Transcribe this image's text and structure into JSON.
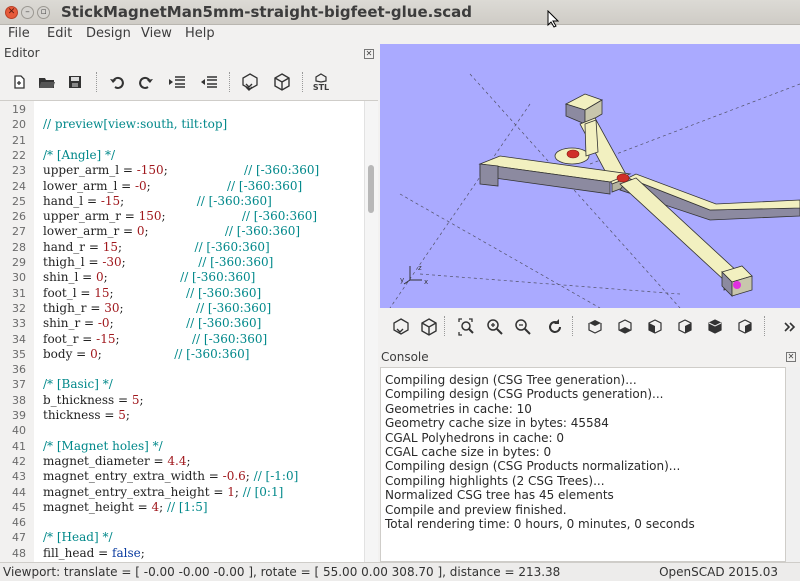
{
  "window": {
    "title": "StickMagnetMan5mm-straight-bigfeet-glue.scad"
  },
  "menu": [
    "File",
    "Edit",
    "Design",
    "View",
    "Help"
  ],
  "editor": {
    "label": "Editor",
    "toolbar": [
      {
        "name": "new-file-icon"
      },
      {
        "name": "open-file-icon"
      },
      {
        "name": "save-icon"
      },
      {
        "name": "undo-icon"
      },
      {
        "name": "redo-icon"
      },
      {
        "name": "indent-icon"
      },
      {
        "name": "unindent-icon"
      },
      {
        "name": "preview-icon"
      },
      {
        "name": "render-icon"
      },
      {
        "name": "export-stl-icon",
        "text": "STL"
      }
    ],
    "lines": [
      {
        "n": "19",
        "parts": []
      },
      {
        "n": "20",
        "parts": [
          {
            "t": "// preview[view:south, tilt:top]",
            "c": "cm"
          }
        ]
      },
      {
        "n": "21",
        "parts": []
      },
      {
        "n": "22",
        "parts": [
          {
            "t": "/* [Angle] */",
            "c": "cm"
          }
        ]
      },
      {
        "n": "23",
        "parts": [
          {
            "t": "upper_arm_l = ",
            "c": ""
          },
          {
            "t": "-150",
            "c": "num"
          },
          {
            "t": ";                    ",
            "c": ""
          },
          {
            "t": "// [-360:360]",
            "c": "cm"
          }
        ]
      },
      {
        "n": "24",
        "parts": [
          {
            "t": "lower_arm_l = ",
            "c": ""
          },
          {
            "t": "-0",
            "c": "num"
          },
          {
            "t": ";                    ",
            "c": ""
          },
          {
            "t": "// [-360:360]",
            "c": "cm"
          }
        ]
      },
      {
        "n": "25",
        "parts": [
          {
            "t": "hand_l = ",
            "c": ""
          },
          {
            "t": "-15",
            "c": "num"
          },
          {
            "t": ";                   ",
            "c": ""
          },
          {
            "t": "// [-360:360]",
            "c": "cm"
          }
        ]
      },
      {
        "n": "26",
        "parts": [
          {
            "t": "upper_arm_r = ",
            "c": ""
          },
          {
            "t": "150",
            "c": "num"
          },
          {
            "t": ";                    ",
            "c": ""
          },
          {
            "t": "// [-360:360]",
            "c": "cm"
          }
        ]
      },
      {
        "n": "27",
        "parts": [
          {
            "t": "lower_arm_r = ",
            "c": ""
          },
          {
            "t": "0",
            "c": "num"
          },
          {
            "t": ";                    ",
            "c": ""
          },
          {
            "t": "// [-360:360]",
            "c": "cm"
          }
        ]
      },
      {
        "n": "28",
        "parts": [
          {
            "t": "hand_r = ",
            "c": ""
          },
          {
            "t": "15",
            "c": "num"
          },
          {
            "t": ";                   ",
            "c": ""
          },
          {
            "t": "// [-360:360]",
            "c": "cm"
          }
        ]
      },
      {
        "n": "29",
        "parts": [
          {
            "t": "thigh_l = ",
            "c": ""
          },
          {
            "t": "-30",
            "c": "num"
          },
          {
            "t": ";                   ",
            "c": ""
          },
          {
            "t": "// [-360:360]",
            "c": "cm"
          }
        ]
      },
      {
        "n": "30",
        "parts": [
          {
            "t": "shin_l = ",
            "c": ""
          },
          {
            "t": "0",
            "c": "num"
          },
          {
            "t": ";                   ",
            "c": ""
          },
          {
            "t": "// [-360:360]",
            "c": "cm"
          }
        ]
      },
      {
        "n": "31",
        "parts": [
          {
            "t": "foot_l = ",
            "c": ""
          },
          {
            "t": "15",
            "c": "num"
          },
          {
            "t": ";                   ",
            "c": ""
          },
          {
            "t": "// [-360:360]",
            "c": "cm"
          }
        ]
      },
      {
        "n": "32",
        "parts": [
          {
            "t": "thigh_r = ",
            "c": ""
          },
          {
            "t": "30",
            "c": "num"
          },
          {
            "t": ";                   ",
            "c": ""
          },
          {
            "t": "// [-360:360]",
            "c": "cm"
          }
        ]
      },
      {
        "n": "33",
        "parts": [
          {
            "t": "shin_r = ",
            "c": ""
          },
          {
            "t": "-0",
            "c": "num"
          },
          {
            "t": ";                   ",
            "c": ""
          },
          {
            "t": "// [-360:360]",
            "c": "cm"
          }
        ]
      },
      {
        "n": "34",
        "parts": [
          {
            "t": "foot_r = ",
            "c": ""
          },
          {
            "t": "-15",
            "c": "num"
          },
          {
            "t": ";                   ",
            "c": ""
          },
          {
            "t": "// [-360:360]",
            "c": "cm"
          }
        ]
      },
      {
        "n": "35",
        "parts": [
          {
            "t": "body = ",
            "c": ""
          },
          {
            "t": "0",
            "c": "num"
          },
          {
            "t": ";                   ",
            "c": ""
          },
          {
            "t": "// [-360:360]",
            "c": "cm"
          }
        ]
      },
      {
        "n": "36",
        "parts": []
      },
      {
        "n": "37",
        "parts": [
          {
            "t": "/* [Basic] */",
            "c": "cm"
          }
        ]
      },
      {
        "n": "38",
        "parts": [
          {
            "t": "b_thickness = ",
            "c": ""
          },
          {
            "t": "5",
            "c": "num"
          },
          {
            "t": ";",
            "c": ""
          }
        ]
      },
      {
        "n": "39",
        "parts": [
          {
            "t": "thickness = ",
            "c": ""
          },
          {
            "t": "5",
            "c": "num"
          },
          {
            "t": ";",
            "c": ""
          }
        ]
      },
      {
        "n": "40",
        "parts": []
      },
      {
        "n": "41",
        "parts": [
          {
            "t": "/* [Magnet holes] */",
            "c": "cm"
          }
        ]
      },
      {
        "n": "42",
        "parts": [
          {
            "t": "magnet_diameter = ",
            "c": ""
          },
          {
            "t": "4.4",
            "c": "num"
          },
          {
            "t": ";",
            "c": ""
          }
        ]
      },
      {
        "n": "43",
        "parts": [
          {
            "t": "magnet_entry_extra_width = ",
            "c": ""
          },
          {
            "t": "-0.6",
            "c": "num"
          },
          {
            "t": "; ",
            "c": ""
          },
          {
            "t": "// [-1:0]",
            "c": "cm"
          }
        ]
      },
      {
        "n": "44",
        "parts": [
          {
            "t": "magnet_entry_extra_height = ",
            "c": ""
          },
          {
            "t": "1",
            "c": "num"
          },
          {
            "t": "; ",
            "c": ""
          },
          {
            "t": "// [0:1]",
            "c": "cm"
          }
        ]
      },
      {
        "n": "45",
        "parts": [
          {
            "t": "magnet_height = ",
            "c": ""
          },
          {
            "t": "4",
            "c": "num"
          },
          {
            "t": "; ",
            "c": ""
          },
          {
            "t": "// [1:5]",
            "c": "cm"
          }
        ]
      },
      {
        "n": "46",
        "parts": []
      },
      {
        "n": "47",
        "parts": [
          {
            "t": "/* [Head] */",
            "c": "cm"
          }
        ]
      },
      {
        "n": "48",
        "parts": [
          {
            "t": "fill_head = ",
            "c": ""
          },
          {
            "t": "false",
            "c": "kw"
          },
          {
            "t": ";",
            "c": ""
          }
        ]
      }
    ]
  },
  "view_toolbar": [
    "preview-icon",
    "render-icon",
    "zoom-all-icon",
    "zoom-in-icon",
    "zoom-out-icon",
    "reset-view-icon",
    "view-top-icon",
    "view-bottom-icon",
    "view-left-icon",
    "view-right-icon",
    "view-front-icon",
    "view-back-icon",
    "more-icon"
  ],
  "console": {
    "label": "Console",
    "lines": [
      "Compiling design (CSG Tree generation)...",
      "Compiling design (CSG Products generation)...",
      "Geometries in cache: 10",
      "Geometry cache size in bytes: 45584",
      "CGAL Polyhedrons in cache: 0",
      "CGAL cache size in bytes: 0",
      "Compiling design (CSG Products normalization)...",
      "Compiling highlights (2 CSG Trees)...",
      "Normalized CSG tree has 45 elements",
      "Compile and preview finished.",
      "Total rendering time: 0 hours, 0 minutes, 0 seconds"
    ]
  },
  "status": {
    "left": "Viewport: translate = [ -0.00 -0.00 -0.00 ], rotate = [ 55.00 0.00 308.70 ], distance = 213.38",
    "right": "OpenSCAD 2015.03"
  },
  "colors": {
    "viewport_bg": "#aaaaff",
    "model_face": "#f2f0c0",
    "magnet_hole": "#e8302c",
    "highlight": "#e030e0"
  }
}
